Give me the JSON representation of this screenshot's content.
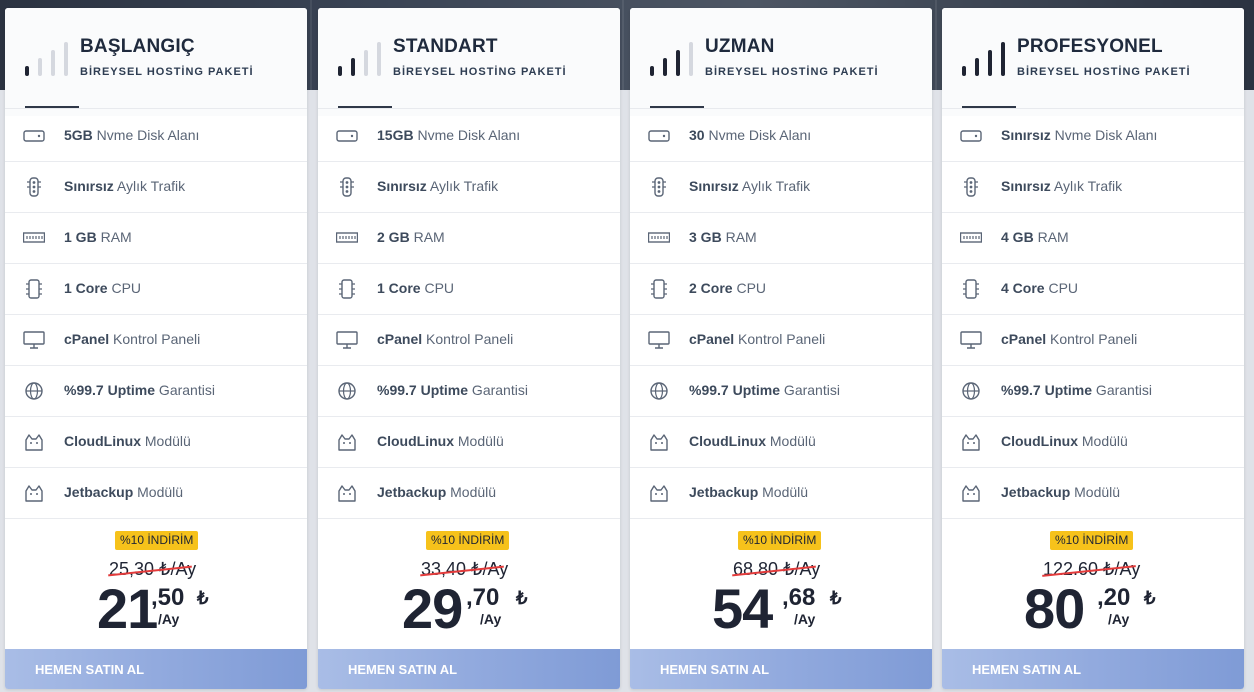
{
  "plans": [
    {
      "level": 1,
      "title": "BAŞLANGIÇ",
      "subtitle": "BİREYSEL HOSTİNG PAKETİ",
      "features": [
        {
          "icon": "hard-drive-icon",
          "bold": "5GB",
          "text": " Nvme Disk Alanı"
        },
        {
          "icon": "traffic-light-icon",
          "bold": "Sınırsız",
          "text": " Aylık Trafik"
        },
        {
          "icon": "memory-icon",
          "bold": "1 GB",
          "text": " RAM"
        },
        {
          "icon": "cpu-icon",
          "bold": "1 Core",
          "text": " CPU"
        },
        {
          "icon": "monitor-icon",
          "bold": "cPanel",
          "text": " Kontrol Paneli"
        },
        {
          "icon": "globe-icon",
          "bold": "%99.7 Uptime",
          "text": " Garantisi"
        },
        {
          "icon": "cat-icon",
          "bold": "CloudLinux",
          "text": " Modülü"
        },
        {
          "icon": "cat-icon",
          "bold": "Jetbackup",
          "text": " Modülü"
        }
      ],
      "badge": "%10 İNDİRİM",
      "old_price": "25,30 ₺/Ay",
      "price_int": "21",
      "price_dec": ",50",
      "currency": "₺",
      "per": "/Ay",
      "button": "HEMEN SATIN AL"
    },
    {
      "level": 2,
      "title": "STANDART",
      "subtitle": "BİREYSEL HOSTİNG PAKETİ",
      "features": [
        {
          "icon": "hard-drive-icon",
          "bold": "15GB",
          "text": " Nvme Disk Alanı"
        },
        {
          "icon": "traffic-light-icon",
          "bold": "Sınırsız",
          "text": " Aylık Trafik"
        },
        {
          "icon": "memory-icon",
          "bold": "2 GB",
          "text": " RAM"
        },
        {
          "icon": "cpu-icon",
          "bold": "1 Core",
          "text": " CPU"
        },
        {
          "icon": "monitor-icon",
          "bold": "cPanel",
          "text": " Kontrol Paneli"
        },
        {
          "icon": "globe-icon",
          "bold": "%99.7 Uptime",
          "text": " Garantisi"
        },
        {
          "icon": "cat-icon",
          "bold": "CloudLinux",
          "text": " Modülü"
        },
        {
          "icon": "cat-icon",
          "bold": "Jetbackup",
          "text": " Modülü"
        }
      ],
      "badge": "%10 İNDİRİM",
      "old_price": "33,40 ₺/Ay",
      "price_int": "29",
      "price_dec": ",70",
      "currency": "₺",
      "per": "/Ay",
      "button": "HEMEN SATIN AL"
    },
    {
      "level": 3,
      "title": "UZMAN",
      "subtitle": "BİREYSEL HOSTİNG PAKETİ",
      "features": [
        {
          "icon": "hard-drive-icon",
          "bold": "30",
          "text": " Nvme Disk Alanı"
        },
        {
          "icon": "traffic-light-icon",
          "bold": "Sınırsız",
          "text": " Aylık Trafik"
        },
        {
          "icon": "memory-icon",
          "bold": "3 GB",
          "text": " RAM"
        },
        {
          "icon": "cpu-icon",
          "bold": "2 Core",
          "text": " CPU"
        },
        {
          "icon": "monitor-icon",
          "bold": "cPanel",
          "text": " Kontrol Paneli"
        },
        {
          "icon": "globe-icon",
          "bold": "%99.7 Uptime",
          "text": " Garantisi"
        },
        {
          "icon": "cat-icon",
          "bold": "CloudLinux",
          "text": " Modülü"
        },
        {
          "icon": "cat-icon",
          "bold": "Jetbackup",
          "text": " Modülü"
        }
      ],
      "badge": "%10 İNDİRİM",
      "old_price": "68.80 ₺/Ay",
      "price_int": "54",
      "price_dec": ",68",
      "currency": "₺",
      "per": "/Ay",
      "button": "HEMEN SATIN AL"
    },
    {
      "level": 4,
      "title": "PROFESYONEL",
      "subtitle": "BİREYSEL HOSTİNG PAKETİ",
      "features": [
        {
          "icon": "hard-drive-icon",
          "bold": "Sınırsız",
          "text": " Nvme Disk Alanı"
        },
        {
          "icon": "traffic-light-icon",
          "bold": "Sınırsız",
          "text": " Aylık Trafik"
        },
        {
          "icon": "memory-icon",
          "bold": "4 GB",
          "text": " RAM"
        },
        {
          "icon": "cpu-icon",
          "bold": "4 Core",
          "text": " CPU"
        },
        {
          "icon": "monitor-icon",
          "bold": "cPanel",
          "text": " Kontrol Paneli"
        },
        {
          "icon": "globe-icon",
          "bold": "%99.7 Uptime",
          "text": " Garantisi"
        },
        {
          "icon": "cat-icon",
          "bold": "CloudLinux",
          "text": " Modülü"
        },
        {
          "icon": "cat-icon",
          "bold": "Jetbackup",
          "text": " Modülü"
        }
      ],
      "badge": "%10 İNDİRİM",
      "old_price": "122.60 ₺/Ay",
      "price_int": "80",
      "price_dec": ",20",
      "currency": "₺",
      "per": "/Ay",
      "button": "HEMEN SATIN AL"
    }
  ],
  "colors": {
    "badge": "#f6c21b",
    "strike": "#e33b3b",
    "button_start": "#a9bde6",
    "button_end": "#7f9bd6",
    "text_dark": "#1f2433"
  }
}
